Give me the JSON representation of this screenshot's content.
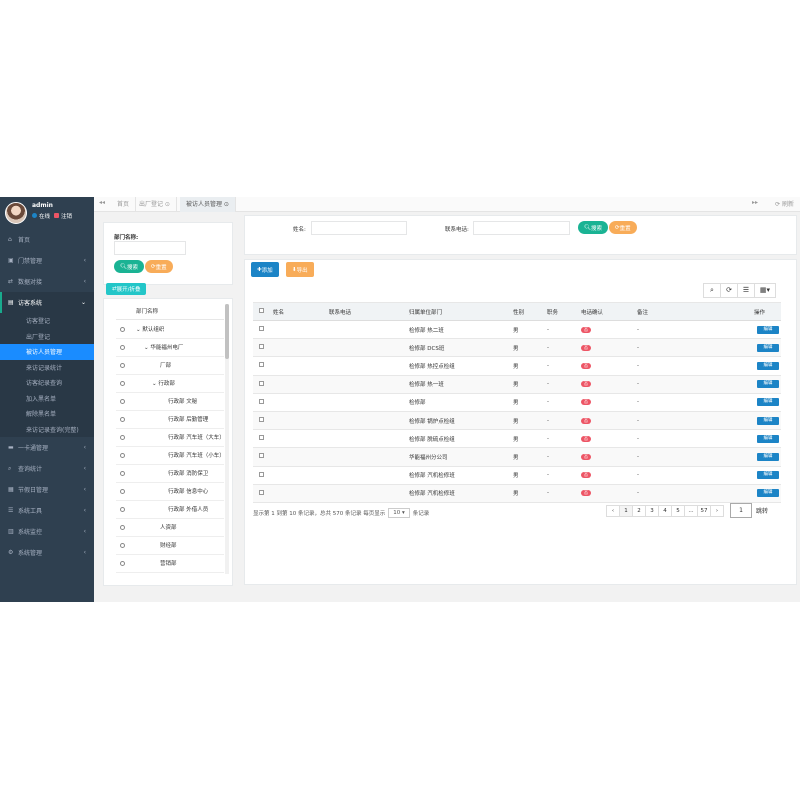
{
  "user": {
    "name": "admin",
    "online": "在线",
    "logout": "注销"
  },
  "sidebar": {
    "items": [
      {
        "icon": "home-icon",
        "label": "首页",
        "arrow": ""
      },
      {
        "icon": "door-icon",
        "label": "门禁管理",
        "arrow": "‹"
      },
      {
        "icon": "link-icon",
        "label": "数据对接",
        "arrow": "‹"
      },
      {
        "icon": "visitor-icon",
        "label": "访客系统",
        "arrow": "⌄"
      }
    ],
    "sub_items": [
      {
        "label": "访客登记"
      },
      {
        "label": "出厂登记"
      },
      {
        "label": "被访人员管理"
      },
      {
        "label": "来访记录统计"
      },
      {
        "label": "访客纪录查询"
      },
      {
        "label": "加入黑名单"
      },
      {
        "label": "解除黑名单"
      },
      {
        "label": "来访记录查询(完整)"
      }
    ],
    "items2": [
      {
        "icon": "card-icon",
        "label": "一卡通管理",
        "arrow": "‹"
      },
      {
        "icon": "query-icon",
        "label": "查询统计",
        "arrow": "‹"
      },
      {
        "icon": "calendar-icon",
        "label": "节假日管理",
        "arrow": "‹"
      },
      {
        "icon": "tools-icon",
        "label": "系统工具",
        "arrow": "‹"
      },
      {
        "icon": "monitor-icon",
        "label": "系统监控",
        "arrow": "‹"
      },
      {
        "icon": "gear-icon",
        "label": "系统管理",
        "arrow": "‹"
      }
    ]
  },
  "tabs": [
    {
      "label": "首页"
    },
    {
      "label": "出厂登记 ⊙"
    },
    {
      "label": "被访人员管理 ⊙"
    }
  ],
  "tabbar": {
    "left": "◂◂",
    "right": "▸▸",
    "refresh": "⟳ 刷新"
  },
  "dept_search": {
    "label": "部门名称:",
    "search": "搜索",
    "reset": "重置",
    "expand": "展开/折叠"
  },
  "tree": {
    "header": "部门名称",
    "rows": [
      {
        "label": "⌄ 默认组织",
        "indent": 20
      },
      {
        "label": "⌄ 华能福州电厂",
        "indent": 28
      },
      {
        "label": "厂部",
        "indent": 44
      },
      {
        "label": "⌄ 行政部",
        "indent": 36
      },
      {
        "label": "行政部 文秘",
        "indent": 52
      },
      {
        "label": "行政部 后勤管理",
        "indent": 52
      },
      {
        "label": "行政部 汽车班（大车）",
        "indent": 52
      },
      {
        "label": "行政部 汽车班（小车）",
        "indent": 52
      },
      {
        "label": "行政部 消防保卫",
        "indent": 52
      },
      {
        "label": "行政部 信息中心",
        "indent": 52
      },
      {
        "label": "行政部 外借人员",
        "indent": 52
      },
      {
        "label": "人资部",
        "indent": 44
      },
      {
        "label": "财经部",
        "indent": 44
      },
      {
        "label": "营销部",
        "indent": 44
      }
    ]
  },
  "filter": {
    "name_label": "姓名:",
    "phone_label": "联系电话:",
    "search": "搜索",
    "reset": "重置"
  },
  "toolbar": {
    "add": "添加",
    "export": "导出"
  },
  "table": {
    "columns": [
      "姓名",
      "联系电话",
      "归属单位部门",
      "性别",
      "职务",
      "电话确认",
      "备注",
      "操作"
    ],
    "rows": [
      {
        "dept": "检修部 热二班",
        "gender": "男",
        "post": "-",
        "note": "-"
      },
      {
        "dept": "检修部 DCS班",
        "gender": "男",
        "post": "-",
        "note": "-"
      },
      {
        "dept": "检修部 热控点检组",
        "gender": "男",
        "post": "-",
        "note": "-"
      },
      {
        "dept": "检修部 热一班",
        "gender": "男",
        "post": "-",
        "note": "-"
      },
      {
        "dept": "检修部",
        "gender": "男",
        "post": "-",
        "note": "-"
      },
      {
        "dept": "检修部 锅炉点检组",
        "gender": "男",
        "post": "-",
        "note": "-"
      },
      {
        "dept": "检修部 脱硫点检组",
        "gender": "男",
        "post": "-",
        "note": "-"
      },
      {
        "dept": "华能福州分公司",
        "gender": "男",
        "post": "-",
        "note": "-"
      },
      {
        "dept": "检修部 汽机检修班",
        "gender": "男",
        "post": "-",
        "note": "-"
      },
      {
        "dept": "检修部 汽机检修班",
        "gender": "男",
        "post": "-",
        "note": "-"
      }
    ],
    "confirm_label": "否",
    "edit_label": "编辑"
  },
  "pagination": {
    "info": "显示第 1 到第 10 条记录，总共 570 条记录 每页显示",
    "page_size": "10 ▾",
    "suffix": "条记录",
    "pages": [
      "‹",
      "1",
      "2",
      "3",
      "4",
      "5",
      "...",
      "57",
      "›"
    ],
    "goto_value": "1",
    "goto_label": "跳转"
  }
}
